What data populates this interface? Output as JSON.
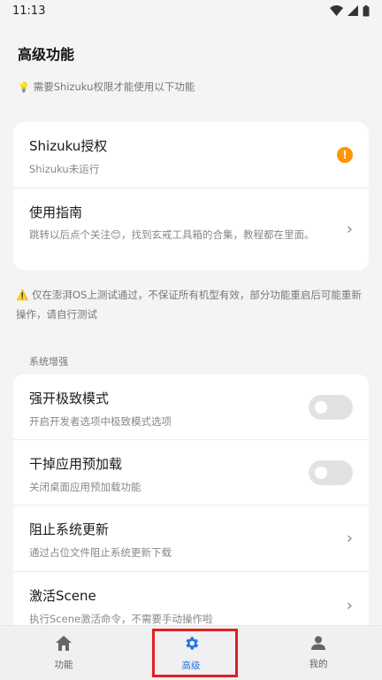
{
  "status_bar": {
    "time": "11:13"
  },
  "page": {
    "title": "高级功能",
    "hint": "需要Shizuku权限才能使用以下功能",
    "warning": "仅在澎湃OS上测试通过，不保证所有机型有效，部分功能重启后可能重新操作，请自行测试",
    "section_label": "系统增强"
  },
  "card1": {
    "shizuku_title": "Shizuku授权",
    "shizuku_sub": "Shizuku未运行",
    "shizuku_badge": "!",
    "guide_title": "使用指南",
    "guide_sub": "跳转以后点个关注😊，找到玄戒工具箱的合集，教程都在里面。"
  },
  "card2": {
    "items": [
      {
        "title": "强开极致模式",
        "sub": "开启开发者选项中极致模式选项",
        "control": "toggle",
        "on": false
      },
      {
        "title": "干掉应用预加载",
        "sub": "关闭桌面应用预加载功能",
        "control": "toggle",
        "on": false
      },
      {
        "title": "阻止系统更新",
        "sub": "通过占位文件阻止系统更新下载",
        "control": "chevron"
      },
      {
        "title": "激活Scene",
        "sub": "执行Scene激活命令，不需要手动操作啦",
        "control": "chevron"
      }
    ]
  },
  "bottom_nav": {
    "items": [
      {
        "label": "功能",
        "icon": "home-icon"
      },
      {
        "label": "高级",
        "icon": "gear-icon",
        "active": true
      },
      {
        "label": "我的",
        "icon": "person-icon"
      }
    ]
  },
  "colors": {
    "accent": "#2176e8",
    "warn": "#ff9500",
    "highlight": "#e02020"
  }
}
